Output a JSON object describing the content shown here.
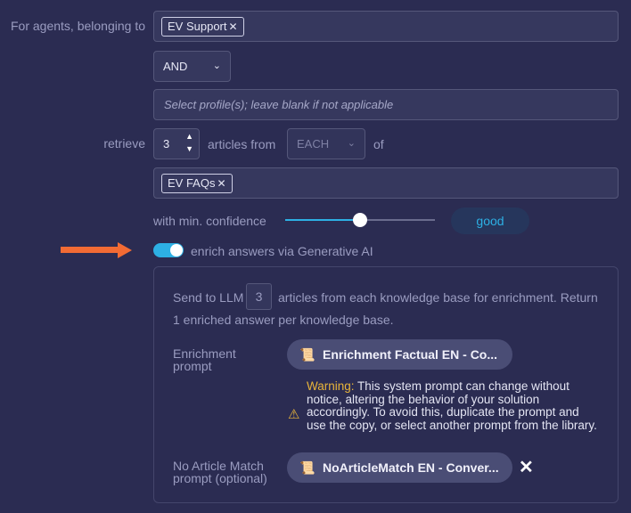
{
  "agents": {
    "label": "For agents, belonging to",
    "chips": [
      "EV Support"
    ],
    "operator": "AND",
    "profiles_placeholder": "Select profile(s); leave blank if not applicable"
  },
  "retrieve": {
    "label": "retrieve",
    "count": "3",
    "articles_from": "articles from",
    "scope": "EACH",
    "of": "of",
    "knowledge_bases": [
      "EV FAQs"
    ]
  },
  "confidence": {
    "label": "with min. confidence",
    "value_fraction": 0.5,
    "level": "good",
    "accent": "#2db0e4"
  },
  "enrich": {
    "toggle_on": true,
    "label": "enrich answers via Generative AI",
    "arrow_color": "#f26b34"
  },
  "panel": {
    "send_prefix": "Send to LLM",
    "send_count": "3",
    "send_suffix": "articles from each knowledge base for enrichment. Return",
    "send_line2": "1 enriched answer per knowledge base.",
    "enrichment_label": "Enrichment prompt",
    "enrichment_value": "Enrichment Factual EN - Co...",
    "warning_label": "Warning:",
    "warning_text": "This system prompt can change without notice, altering the behavior of your solution accordingly. To avoid this, duplicate the prompt and use the copy, or select another prompt from the library.",
    "warning_color": "#e8b43a",
    "noarticle_label": "No Article Match prompt (optional)",
    "noarticle_value": "NoArticleMatch EN - Conver..."
  }
}
